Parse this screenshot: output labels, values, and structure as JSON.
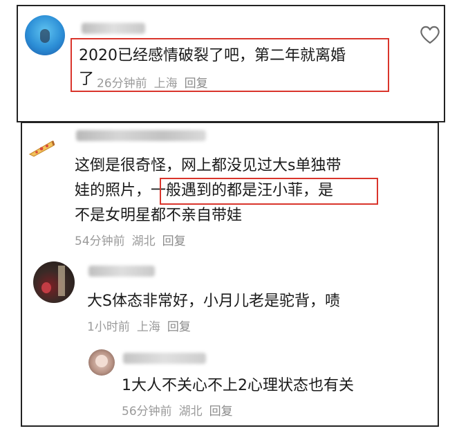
{
  "comments": [
    {
      "text_line1": "2020已经感情破裂了吧，第二年就离婚",
      "text_line2": "了",
      "time": "26分钟前",
      "location": "上海",
      "reply_label": "回复",
      "icon": "heart-outline-icon"
    },
    {
      "text_line1": "这倒是很奇怪，网上都没见过大s单独带",
      "text_line2_a": "娃的照片，",
      "text_line2_highlight": "一般遇到的都是汪小菲，",
      "text_line2_b": "是",
      "text_line3": "不是女明星都不亲自带娃",
      "time": "54分钟前",
      "location": "湖北",
      "reply_label": "回复",
      "avatar_icon": "pizza-slice-icon"
    },
    {
      "text": "大S体态非常好，小月儿老是驼背，啧",
      "time": "1小时前",
      "location": "上海",
      "reply_label": "回复"
    },
    {
      "text": "1大人不关心不上2心理状态也有关",
      "time": "56分钟前",
      "location": "湖北",
      "reply_label": "回复"
    }
  ],
  "colors": {
    "highlight": "#d9342b",
    "frame": "#222222",
    "meta": "#9a9a9a"
  }
}
